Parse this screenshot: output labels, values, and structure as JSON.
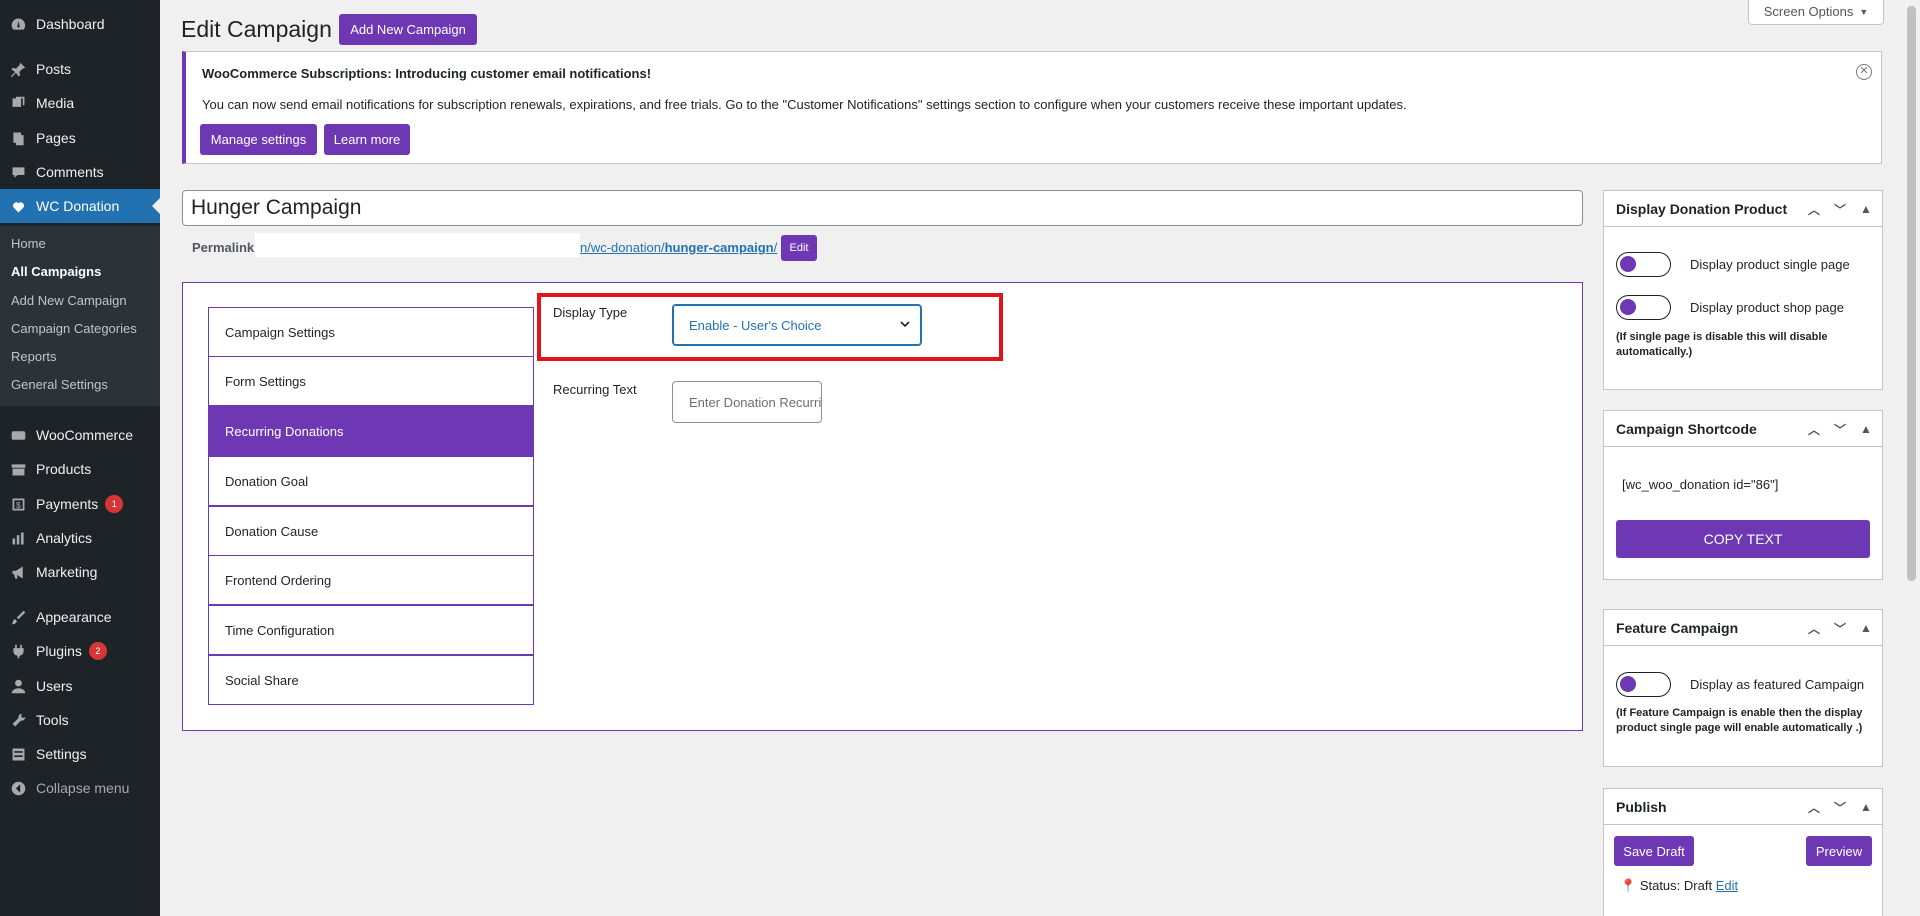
{
  "sidebar": {
    "items": [
      {
        "label": "Dashboard",
        "icon": "dashboard-icon"
      },
      {
        "label": "Posts",
        "icon": "pin-icon"
      },
      {
        "label": "Media",
        "icon": "media-icon"
      },
      {
        "label": "Pages",
        "icon": "pages-icon"
      },
      {
        "label": "Comments",
        "icon": "comment-icon"
      },
      {
        "label": "WC Donation",
        "icon": "heart-icon"
      },
      {
        "label": "WooCommerce",
        "icon": "woo-icon"
      },
      {
        "label": "Products",
        "icon": "archive-icon"
      },
      {
        "label": "Payments",
        "icon": "dollar-icon",
        "badge": "1"
      },
      {
        "label": "Analytics",
        "icon": "bar-chart-icon"
      },
      {
        "label": "Marketing",
        "icon": "megaphone-icon"
      },
      {
        "label": "Appearance",
        "icon": "brush-icon"
      },
      {
        "label": "Plugins",
        "icon": "plugin-icon",
        "badge": "2"
      },
      {
        "label": "Users",
        "icon": "user-icon"
      },
      {
        "label": "Tools",
        "icon": "wrench-icon"
      },
      {
        "label": "Settings",
        "icon": "settings-icon"
      }
    ],
    "submenu": [
      "Home",
      "All Campaigns",
      "Add New Campaign",
      "Campaign Categories",
      "Reports",
      "General Settings"
    ],
    "collapse": "Collapse menu"
  },
  "header": {
    "title": "Edit Campaign",
    "add_new": "Add New Campaign",
    "screen_options": "Screen Options"
  },
  "notice": {
    "title": "WooCommerce Subscriptions: Introducing customer email notifications!",
    "body": "You can now send email notifications for subscription renewals, expirations, and free trials. Go to the \"Customer Notifications\" settings section to configure when your customers receive these important updates.",
    "manage": "Manage settings",
    "learn": "Learn more"
  },
  "post": {
    "title": "Hunger Campaign",
    "permalink_label": "Permalink:",
    "permalink_prefix": "n/wc-donation/",
    "permalink_slug": "hunger-campaign",
    "permalink_suffix": "/",
    "edit": "Edit"
  },
  "tabs": [
    "Campaign Settings",
    "Form Settings",
    "Recurring Donations",
    "Donation Goal",
    "Donation Cause",
    "Frontend Ordering",
    "Time Configuration",
    "Social Share"
  ],
  "recurring": {
    "display_type_label": "Display Type",
    "display_type_value": "Enable - User's Choice",
    "recurring_text_label": "Recurring Text",
    "recurring_text_placeholder": "Enter Donation Recurring Text"
  },
  "boxes": {
    "display_product": {
      "title": "Display Donation Product",
      "single": "Display product single page",
      "shop": "Display product shop page",
      "note": "(If single page is disable this will disable automatically.)"
    },
    "shortcode": {
      "title": "Campaign Shortcode",
      "code": "[wc_woo_donation id=\"86\"]",
      "copy": "COPY TEXT"
    },
    "feature": {
      "title": "Feature Campaign",
      "option": "Display as featured Campaign",
      "note": "(If Feature Campaign is enable then the display product single page will enable automatically .)"
    },
    "publish": {
      "title": "Publish",
      "save_draft": "Save Draft",
      "preview": "Preview",
      "status_label": "Status:",
      "status_value": "Draft",
      "status_edit": "Edit"
    }
  },
  "colors": {
    "accent": "#6e37b3",
    "sidebar": "#1d2327",
    "active_menu": "#2271b1",
    "highlight": "#e3121b"
  }
}
